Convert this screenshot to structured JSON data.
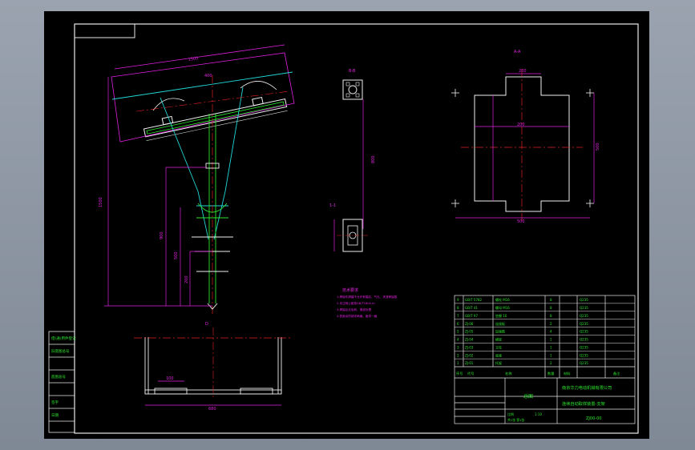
{
  "drawing": {
    "section_label": "B-B",
    "view_label": "A-A",
    "tag_label": "1-1",
    "bottom_view_label": "D",
    "dims": {
      "top_slant": "1500",
      "top_span": "400",
      "column_height": "1500",
      "height_a": "900",
      "height_b": "500",
      "height_c": "200",
      "bottom_width": "680",
      "bottom_inner": "100",
      "section_height": "800",
      "plate_width": "500",
      "plate_height": "500",
      "plate_inner": "200",
      "plate_top": "200"
    },
    "notes_title": "技术要求",
    "notes": [
      "1.焊接件焊缝不允许有裂纹、气孔、夹渣等缺陷",
      "2.未注明公差按GB/T1804-m",
      "3.焊接后去毛刺、清渣处理",
      "4.表面涂防锈漆两遍，面漆一遍"
    ]
  },
  "title_block": {
    "parts": [
      {
        "code": "GB/T 5782",
        "name": "螺栓 M16",
        "qty": "8",
        "mat": "Q235"
      },
      {
        "code": "GB/T 41",
        "name": "螺母 M16",
        "qty": "8",
        "mat": "Q235"
      },
      {
        "code": "GB/T 97",
        "name": "垫圈 16",
        "qty": "8",
        "mat": "Q235"
      },
      {
        "code": "ZJ-06",
        "name": "连接板",
        "qty": "2",
        "mat": "Q235"
      },
      {
        "code": "ZJ-05",
        "name": "加强筋",
        "qty": "4",
        "mat": "Q235"
      },
      {
        "code": "ZJ-04",
        "name": "横梁",
        "qty": "1",
        "mat": "Q235"
      },
      {
        "code": "ZJ-03",
        "name": "立柱",
        "qty": "1",
        "mat": "Q235"
      },
      {
        "code": "ZJ-02",
        "name": "底座",
        "qty": "1",
        "mat": "Q235"
      },
      {
        "code": "ZJ-01",
        "name": "托架",
        "qty": "2",
        "mat": "Q235"
      }
    ],
    "header_cols": [
      "序号",
      "代号",
      "名称",
      "数量",
      "材料",
      "备注"
    ],
    "company": "南京华力电动机械有限公司",
    "assembly_label": "总图",
    "product_name": "连续自动取样装置-支架",
    "drawing_no": "ZJ00-00",
    "scale_label": "比例",
    "scale": "1:10",
    "sheet_label": "共1张 第1张"
  },
  "side_strip": [
    "借(通)用件登记",
    "旧底图总号",
    "底图总号",
    "签字",
    "日期"
  ]
}
